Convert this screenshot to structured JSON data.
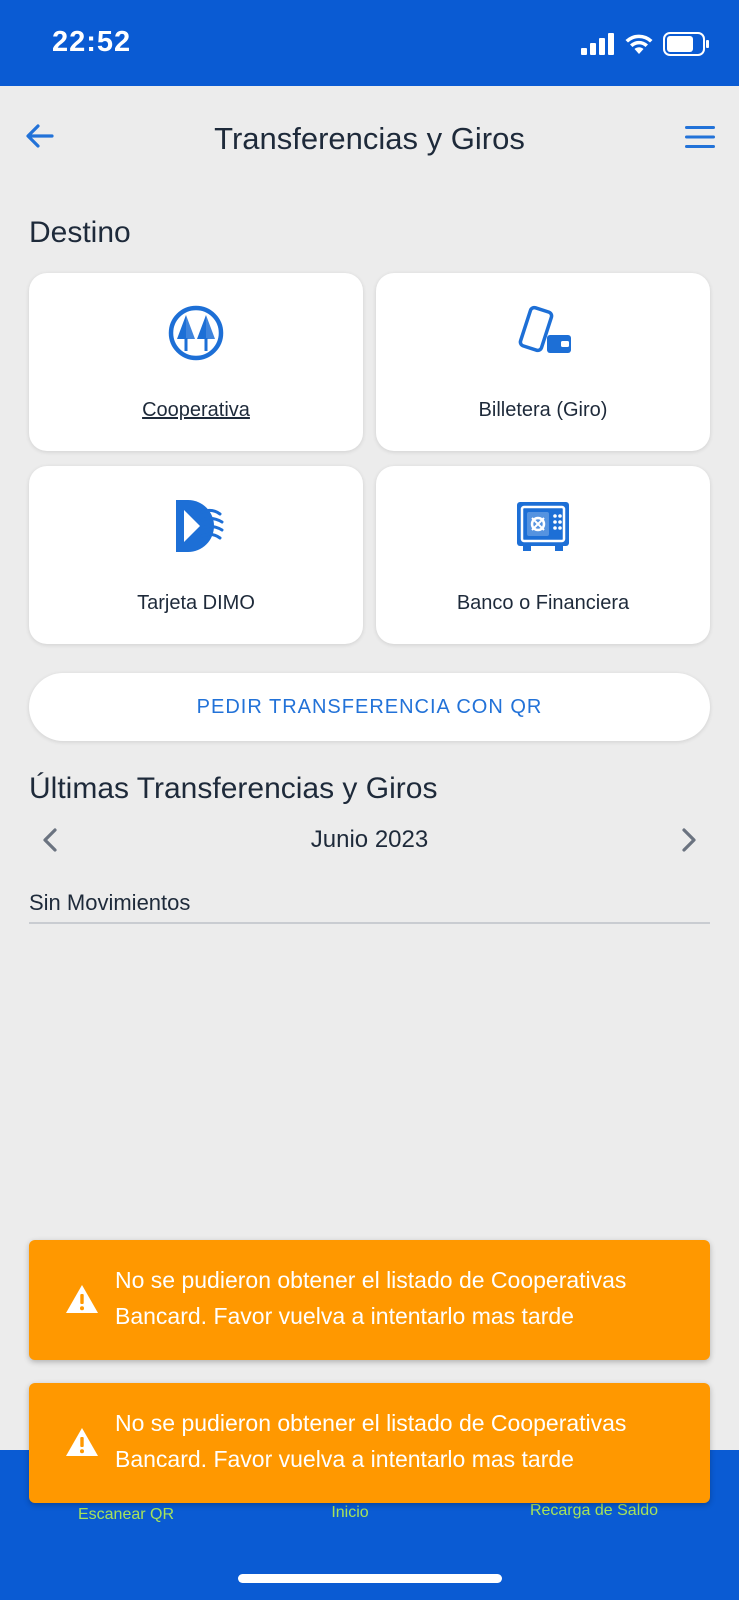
{
  "status_bar": {
    "time": "22:52"
  },
  "header": {
    "title": "Transferencias y Giros"
  },
  "destino": {
    "title": "Destino",
    "cards": [
      {
        "label": "Cooperativa",
        "icon": "cooperativa-icon"
      },
      {
        "label": "Billetera (Giro)",
        "icon": "phone-wallet-icon"
      },
      {
        "label": "Tarjeta DIMO",
        "icon": "dimo-icon"
      },
      {
        "label": "Banco o Financiera",
        "icon": "safe-icon"
      }
    ]
  },
  "qr_button": {
    "label": "PEDIR TRANSFERENCIA CON QR"
  },
  "history": {
    "title": "Últimas Transferencias y Giros",
    "month": "Junio 2023",
    "empty": "Sin Movimientos"
  },
  "toasts": [
    {
      "message": "No se pudieron obtener el listado de Cooperativas Bancard. Favor vuelva a intentarlo mas tarde"
    },
    {
      "message": "No se pudieron obtener el listado de Cooperativas Bancard. Favor vuelva a intentarlo mas tarde"
    }
  ],
  "bottom_nav": {
    "items": [
      {
        "label": "Escanear QR"
      },
      {
        "label": "Inicio"
      },
      {
        "label": "Recarga de Saldo"
      }
    ]
  },
  "colors": {
    "primary": "#0a5bd3",
    "accent_blue": "#2272d8",
    "warning": "#ff9800",
    "nav_text": "#a6e35a",
    "background": "#ececec"
  }
}
